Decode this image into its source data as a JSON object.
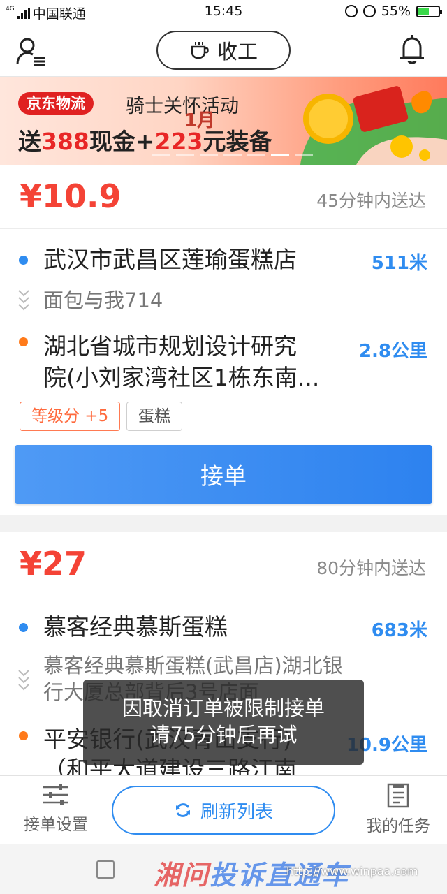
{
  "status_bar": {
    "network": "4G",
    "carrier": "中国联通",
    "time": "15:45",
    "battery": "55%",
    "battery_level": 0.55
  },
  "header": {
    "work_toggle_label": "收工"
  },
  "banner": {
    "tag": "京东物流",
    "subtitle": "骑士关怀活动",
    "main_prefix": "送",
    "cash_amount": "388",
    "main_middle": "现金+",
    "gear_amount": "223",
    "main_suffix": "元装备",
    "month_badge": "1月"
  },
  "orders": [
    {
      "price": "¥10.9",
      "deliver_time": "45分钟内送达",
      "pickup_name": "武汉市武昌区莲瑜蛋糕店",
      "pickup_distance": "511米",
      "pickup_detail": "面包与我714",
      "dropoff_line1": "湖北省城市规划设计研究",
      "dropoff_line2": "院(小刘家湾社区1栋东南...",
      "dropoff_distance": "2.8公里",
      "tags": [
        "等级分 +5",
        "蛋糕"
      ],
      "accept_label": "接单"
    },
    {
      "price": "¥27",
      "deliver_time": "80分钟内送达",
      "pickup_name": "慕客经典慕斯蛋糕",
      "pickup_distance": "683米",
      "pickup_detail_line1": "慕客经典慕斯蛋糕(武昌店)湖北银",
      "pickup_detail_line2": "行大厦总部背后3号店面",
      "dropoff_line1": "平安银行(武汉青山支行)",
      "dropoff_line2": "（和平大道建设三路江南",
      "dropoff_distance": "10.9公里"
    }
  ],
  "toast": {
    "line1": "因取消订单被限制接单",
    "line2": "请75分钟后再试"
  },
  "bottom_bar": {
    "settings_label": "接单设置",
    "refresh_label": "刷新列表",
    "tasks_label": "我的任务"
  },
  "watermark": {
    "text_red": "湘问",
    "text_blue": "投诉直通车",
    "url": "http://www.winpaa.com"
  },
  "colors": {
    "price": "#f44336",
    "accent_blue": "#2f8cf0",
    "orange_dot": "#ff7a1a"
  }
}
